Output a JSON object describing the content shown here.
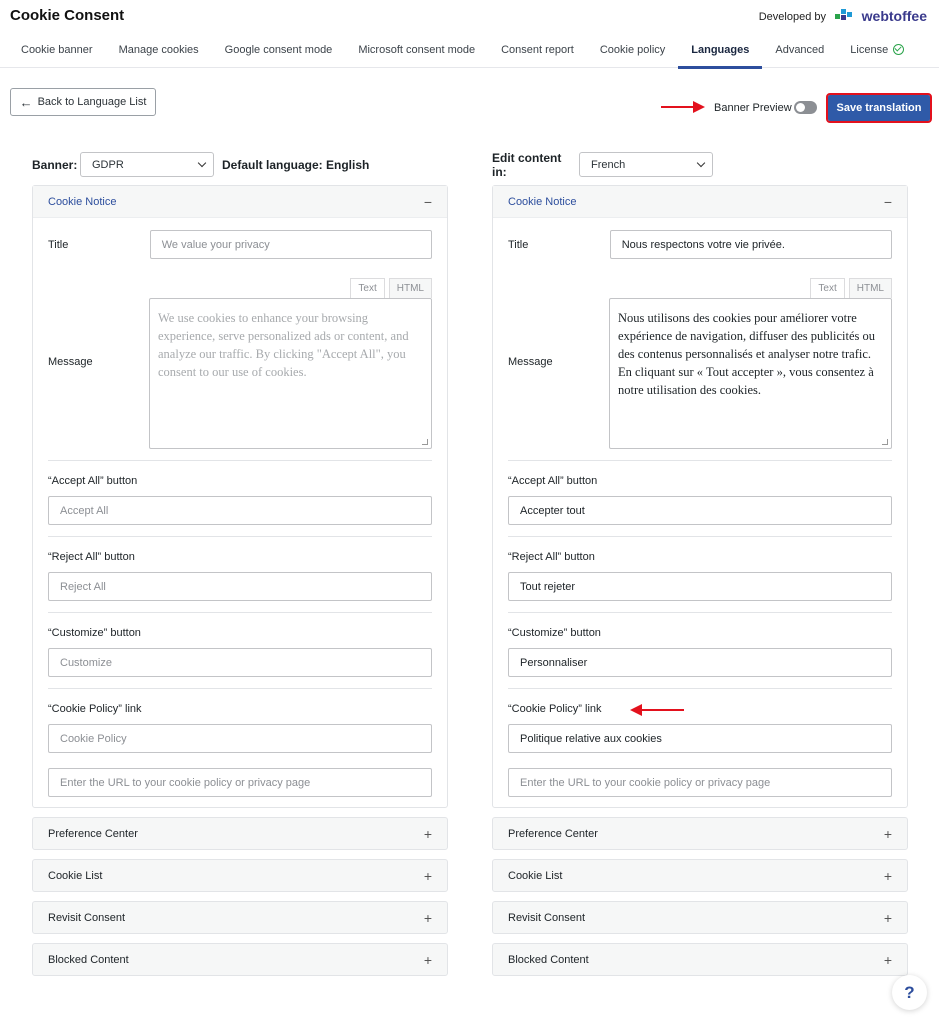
{
  "app": {
    "title": "Cookie Consent",
    "developed_by": "Developed by",
    "brand": "webtoffee"
  },
  "tabs": [
    {
      "label": "Cookie banner"
    },
    {
      "label": "Manage cookies"
    },
    {
      "label": "Google consent mode"
    },
    {
      "label": "Microsoft consent mode"
    },
    {
      "label": "Consent report"
    },
    {
      "label": "Cookie policy"
    },
    {
      "label": "Languages"
    },
    {
      "label": "Advanced"
    },
    {
      "label": "License"
    }
  ],
  "toolbar": {
    "back_label": "Back to Language List",
    "preview_label": "Banner Preview",
    "save_label": "Save translation"
  },
  "left": {
    "banner_label": "Banner:",
    "banner_value": "GDPR",
    "default_lang": "Default language: English",
    "section_title": "Cookie Notice",
    "title_label": "Title",
    "title_placeholder": "We value your privacy",
    "message_label": "Message",
    "tab_text": "Text",
    "tab_html": "HTML",
    "message_placeholder": "We use cookies to enhance your browsing experience, serve personalized ads or content, and analyze our traffic. By clicking \"Accept All\", you consent to our use of cookies.",
    "accept_label": "“Accept All” button",
    "accept_placeholder": "Accept All",
    "reject_label": "“Reject All” button",
    "reject_placeholder": "Reject All",
    "customize_label": "“Customize” button",
    "customize_placeholder": "Customize",
    "policy_label": "“Cookie Policy” link",
    "policy_placeholder": "Cookie Policy",
    "url_placeholder": "Enter the URL to your cookie policy or privacy page"
  },
  "right": {
    "edit_label": "Edit content in:",
    "lang_value": "French",
    "section_title": "Cookie Notice",
    "title_label": "Title",
    "title_value": "Nous respectons votre vie privée.",
    "message_label": "Message",
    "tab_text": "Text",
    "tab_html": "HTML",
    "message_value": "Nous utilisons des cookies pour améliorer votre expérience de navigation, diffuser des publicités ou des contenus personnalisés et analyser notre trafic. En cliquant sur « Tout accepter », vous consentez à notre utilisation des cookies.",
    "accept_label": "“Accept All” button",
    "accept_value": "Accepter tout",
    "reject_label": "“Reject All” button",
    "reject_value": "Tout rejeter",
    "customize_label": "“Customize” button",
    "customize_value": "Personnaliser",
    "policy_label": "“Cookie Policy” link",
    "policy_value": "Politique relative aux cookies",
    "url_placeholder": "Enter the URL to your cookie policy or privacy page"
  },
  "accordions": [
    {
      "label": "Preference Center"
    },
    {
      "label": "Cookie List"
    },
    {
      "label": "Revisit Consent"
    },
    {
      "label": "Blocked Content"
    }
  ],
  "signs": {
    "collapse": "−",
    "expand": "+"
  },
  "help": {
    "label": "?"
  },
  "colors": {
    "accent": "#2f5aa8",
    "annotation": "#e3111d",
    "license_ok": "#2aa34a"
  }
}
